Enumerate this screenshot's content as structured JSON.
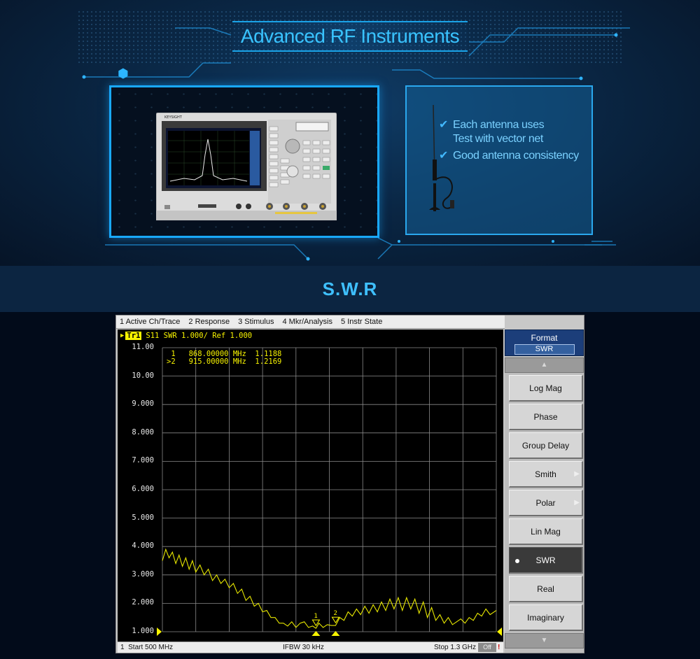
{
  "banner": {
    "title": "Advanced RF Instruments",
    "features": [
      {
        "text": "Each antenna uses",
        "checked": true
      },
      {
        "text": "Test with vector net",
        "checked": false
      },
      {
        "text": "Good antenna consistency",
        "checked": true
      }
    ],
    "instrument_brand": "KEYSIGHT"
  },
  "section_title": "S.W.R",
  "analyzer": {
    "menu": [
      "1 Active Ch/Trace",
      "2 Response",
      "3 Stimulus",
      "4 Mkr/Analysis",
      "5 Instr State"
    ],
    "trace_tag": "Tr1",
    "trace_label": "S11  SWR 1.000/ Ref 1.000",
    "markers": [
      {
        "text": " 1   868.00000 MHz  1.1188"
      },
      {
        "text": ">2   915.00000 MHz  1.2169"
      }
    ],
    "status": {
      "start": "Start 500 MHz",
      "channel": "1",
      "ifbw": "IFBW 30 kHz",
      "stop": "Stop 1.3 GHz",
      "off": "Off",
      "bang": "!"
    },
    "softkeys": {
      "header": "Format",
      "header_value": "SWR",
      "up": "▲",
      "down": "▼",
      "items": [
        {
          "label": "Log Mag",
          "submenu": false,
          "active": false
        },
        {
          "label": "Phase",
          "submenu": false,
          "active": false
        },
        {
          "label": "Group Delay",
          "submenu": false,
          "active": false
        },
        {
          "label": "Smith",
          "submenu": true,
          "active": false
        },
        {
          "label": "Polar",
          "submenu": true,
          "active": false
        },
        {
          "label": "Lin Mag",
          "submenu": false,
          "active": false
        },
        {
          "label": "SWR",
          "submenu": false,
          "active": true
        },
        {
          "label": "Real",
          "submenu": false,
          "active": false
        },
        {
          "label": "Imaginary",
          "submenu": false,
          "active": false
        }
      ]
    }
  },
  "chart_data": {
    "type": "line",
    "title": "S11  SWR 1.000/ Ref 1.000",
    "xlabel": "",
    "ylabel": "",
    "xlim": [
      500,
      1300
    ],
    "ylim": [
      1.0,
      11.0
    ],
    "yticks": [
      "11.00",
      "10.00",
      "9.000",
      "8.000",
      "7.000",
      "6.000",
      "5.000",
      "4.000",
      "3.000",
      "2.000",
      "1.000"
    ],
    "grid": true,
    "series": [
      {
        "name": "",
        "color": "#e8e800",
        "x": [
          500,
          508,
          516,
          524,
          532,
          540,
          548,
          556,
          564,
          572,
          580,
          590,
          600,
          610,
          620,
          630,
          640,
          650,
          660,
          670,
          680,
          690,
          700,
          710,
          720,
          730,
          740,
          750,
          760,
          770,
          780,
          790,
          800,
          810,
          820,
          830,
          840,
          850,
          860,
          868,
          875,
          885,
          895,
          905,
          915,
          925,
          935,
          945,
          955,
          965,
          975,
          985,
          995,
          1005,
          1015,
          1025,
          1035,
          1045,
          1055,
          1065,
          1075,
          1085,
          1095,
          1105,
          1115,
          1125,
          1135,
          1145,
          1155,
          1165,
          1175,
          1185,
          1195,
          1205,
          1215,
          1225,
          1235,
          1245,
          1255,
          1265,
          1275,
          1285,
          1300
        ],
        "y": [
          3.5,
          3.9,
          3.6,
          3.8,
          3.4,
          3.7,
          3.3,
          3.6,
          3.2,
          3.5,
          3.1,
          3.35,
          3.0,
          3.2,
          2.8,
          3.0,
          2.7,
          2.85,
          2.55,
          2.7,
          2.35,
          2.5,
          2.1,
          2.25,
          1.9,
          2.0,
          1.7,
          1.75,
          1.5,
          1.5,
          1.3,
          1.3,
          1.2,
          1.35,
          1.15,
          1.3,
          1.35,
          1.15,
          1.2,
          1.12,
          1.3,
          1.15,
          1.25,
          1.22,
          1.22,
          1.5,
          1.4,
          1.7,
          1.55,
          1.8,
          1.6,
          1.9,
          1.65,
          1.95,
          1.7,
          2.05,
          1.75,
          2.15,
          1.8,
          2.2,
          1.75,
          2.2,
          1.8,
          2.15,
          1.65,
          2.05,
          1.5,
          1.85,
          1.4,
          1.6,
          1.3,
          1.5,
          1.25,
          1.35,
          1.45,
          1.3,
          1.5,
          1.4,
          1.65,
          1.55,
          1.8,
          1.6,
          1.75
        ]
      }
    ],
    "markers": [
      {
        "id": "1",
        "x": 868,
        "y": 1.1188
      },
      {
        "id": "2",
        "x": 915,
        "y": 1.2169
      }
    ]
  }
}
